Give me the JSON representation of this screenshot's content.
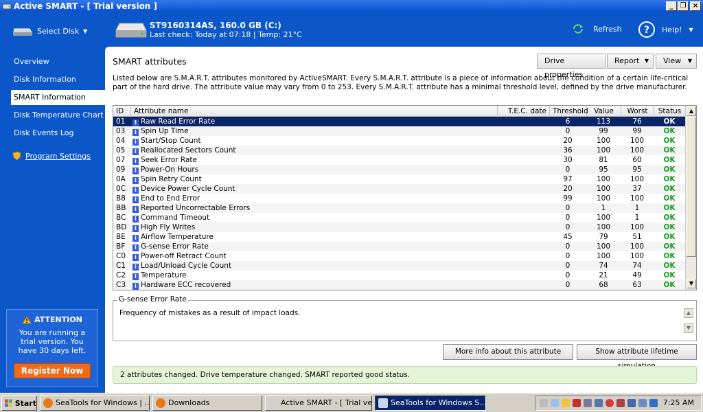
{
  "window": {
    "title": "Active SMART - [ Trial version ]",
    "controls": [
      "_",
      "❐",
      "×"
    ]
  },
  "header": {
    "select_disk": "Select Disk",
    "disk_name": "ST9160314AS, 160.0 GB (C:)",
    "disk_status": "Last check: Today at 07:18 | Temp: 21°C",
    "refresh": "Refresh",
    "help": "Help!"
  },
  "sidebar": {
    "items": [
      {
        "label": "Overview"
      },
      {
        "label": "Disk Information"
      },
      {
        "label": "SMART Information"
      },
      {
        "label": "Disk Temperature Chart"
      },
      {
        "label": "Disk Events Log"
      }
    ],
    "settings": "Program Settings",
    "attention": {
      "title": "ATTENTION",
      "text": "You are running a trial version. You have 30 days left.",
      "button": "Register Now"
    }
  },
  "main": {
    "title": "SMART attributes",
    "buttons": {
      "drive_properties": "Drive properties",
      "report": "Report",
      "view": "View"
    },
    "description": "Listed below are S.M.A.R.T. attributes monitored by ActiveSMART. Every S.M.A.R.T. attribute is a piece of information about the condition of a certain life-critical part of the hard drive. The attribute value may vary from 0 to 253. Every S.M.A.R.T. attribute has a minimal threshold level, defined by the drive manufacturer.",
    "columns": [
      "ID",
      "Attribute name",
      "T.E.C. date",
      "Threshold",
      "Value",
      "Worst",
      "Status"
    ],
    "rows": [
      {
        "id": "01",
        "name": "Raw Read Error Rate",
        "tec": "",
        "threshold": "6",
        "value": "113",
        "worst": "76",
        "status": "OK"
      },
      {
        "id": "03",
        "name": "Spin Up Time",
        "tec": "",
        "threshold": "0",
        "value": "99",
        "worst": "99",
        "status": "OK"
      },
      {
        "id": "04",
        "name": "Start/Stop Count",
        "tec": "",
        "threshold": "20",
        "value": "100",
        "worst": "100",
        "status": "OK"
      },
      {
        "id": "05",
        "name": "Reallocated Sectors Count",
        "tec": "",
        "threshold": "36",
        "value": "100",
        "worst": "100",
        "status": "OK"
      },
      {
        "id": "07",
        "name": "Seek Error Rate",
        "tec": "",
        "threshold": "30",
        "value": "81",
        "worst": "60",
        "status": "OK"
      },
      {
        "id": "09",
        "name": "Power-On Hours",
        "tec": "",
        "threshold": "0",
        "value": "95",
        "worst": "95",
        "status": "OK"
      },
      {
        "id": "0A",
        "name": "Spin Retry Count",
        "tec": "",
        "threshold": "97",
        "value": "100",
        "worst": "100",
        "status": "OK"
      },
      {
        "id": "0C",
        "name": "Device Power Cycle Count",
        "tec": "",
        "threshold": "20",
        "value": "100",
        "worst": "37",
        "status": "OK"
      },
      {
        "id": "B8",
        "name": "End to End Error",
        "tec": "",
        "threshold": "99",
        "value": "100",
        "worst": "100",
        "status": "OK"
      },
      {
        "id": "BB",
        "name": "Reported Uncorrectable Errors",
        "tec": "",
        "threshold": "0",
        "value": "1",
        "worst": "1",
        "status": "OK"
      },
      {
        "id": "BC",
        "name": "Command Timeout",
        "tec": "",
        "threshold": "0",
        "value": "100",
        "worst": "1",
        "status": "OK"
      },
      {
        "id": "BD",
        "name": "High Fly Writes",
        "tec": "",
        "threshold": "0",
        "value": "100",
        "worst": "100",
        "status": "OK"
      },
      {
        "id": "BE",
        "name": "Airflow Temperature",
        "tec": "",
        "threshold": "45",
        "value": "79",
        "worst": "51",
        "status": "OK"
      },
      {
        "id": "BF",
        "name": "G-sense Error Rate",
        "tec": "",
        "threshold": "0",
        "value": "100",
        "worst": "100",
        "status": "OK"
      },
      {
        "id": "C0",
        "name": "Power-off Retract Count",
        "tec": "",
        "threshold": "0",
        "value": "100",
        "worst": "100",
        "status": "OK"
      },
      {
        "id": "C1",
        "name": "Load/Unload Cycle Count",
        "tec": "",
        "threshold": "0",
        "value": "74",
        "worst": "74",
        "status": "OK"
      },
      {
        "id": "C2",
        "name": "Temperature",
        "tec": "",
        "threshold": "0",
        "value": "21",
        "worst": "49",
        "status": "OK"
      },
      {
        "id": "C3",
        "name": "Hardware ECC recovered",
        "tec": "",
        "threshold": "0",
        "value": "68",
        "worst": "63",
        "status": "OK"
      }
    ],
    "detail": {
      "legend": "G-sense Error Rate",
      "text": "Frequency of mistakes as a result of impact loads."
    },
    "more_info": "More info about this attribute",
    "lifetime": "Show attribute lifetime simulation",
    "status": "2 attributes changed. Drive temperature changed. SMART reported good status."
  },
  "taskbar": {
    "start": "Start",
    "tasks": [
      {
        "label": "SeaTools for Windows | ..."
      },
      {
        "label": "Downloads"
      },
      {
        "label": "Active SMART - [ Trial ve..."
      },
      {
        "label": "SeaTools for Windows S..."
      }
    ],
    "clock": "7:25 AM"
  },
  "colors": {
    "accent": "#0b57c9",
    "ok": "#139a1c",
    "selected": "#0a246a",
    "register": "#f06a1a"
  }
}
